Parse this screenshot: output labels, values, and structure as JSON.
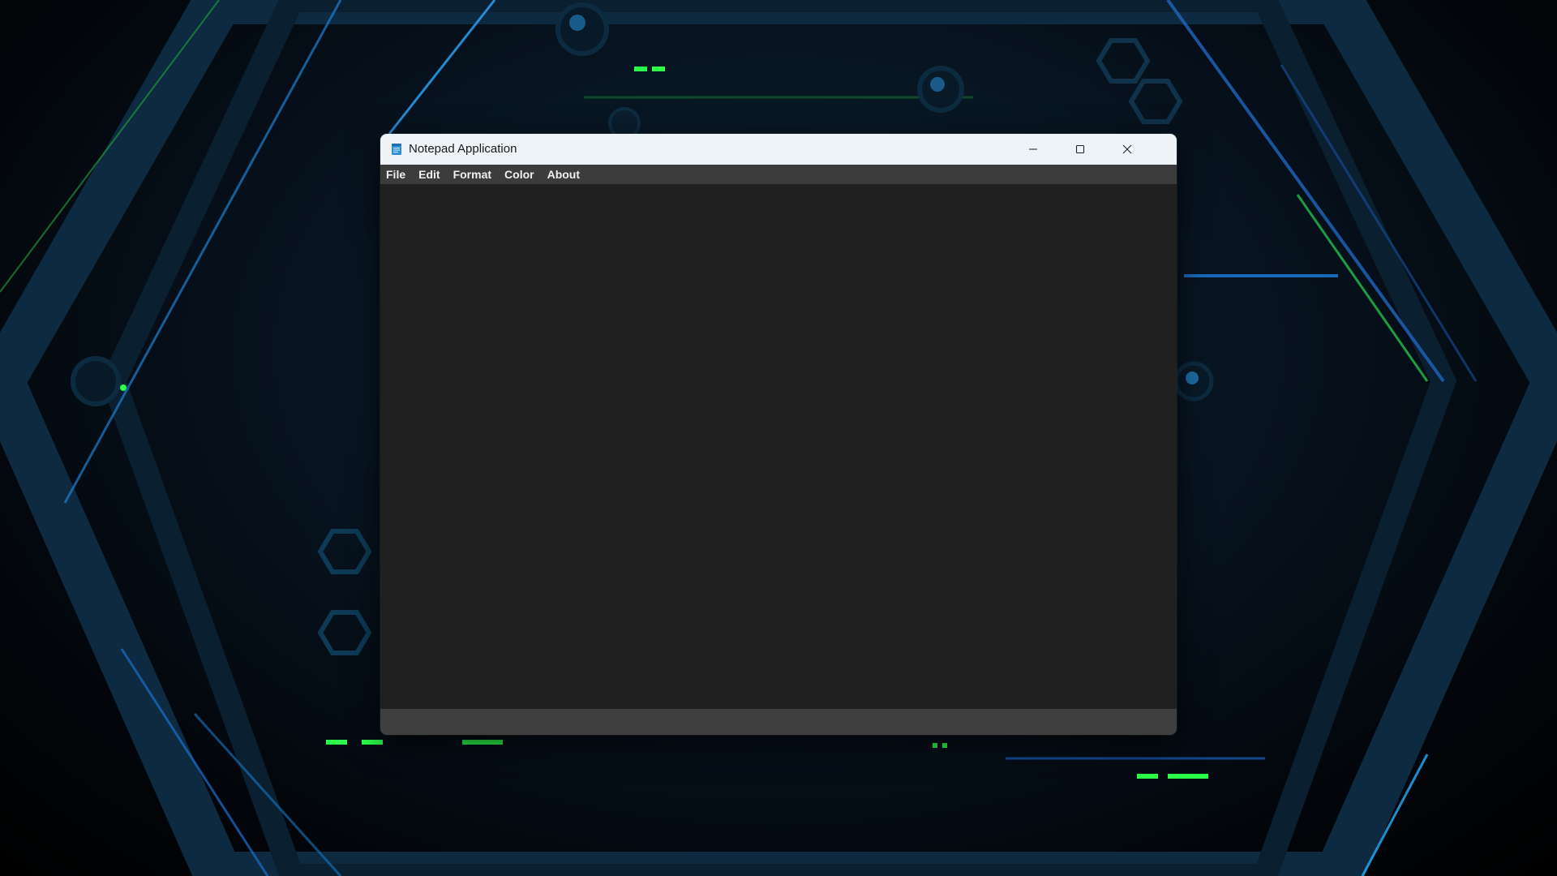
{
  "window": {
    "title": "Notepad Application"
  },
  "menubar": {
    "items": [
      {
        "label": "File"
      },
      {
        "label": "Edit"
      },
      {
        "label": "Format"
      },
      {
        "label": "Color"
      },
      {
        "label": "About"
      }
    ]
  },
  "editor": {
    "content": ""
  },
  "icons": {
    "app": "notepad-icon",
    "minimize": "minimize-icon",
    "maximize": "maximize-icon",
    "close": "close-icon"
  },
  "colors": {
    "titlebar_bg": "#eef3f8",
    "menubar_bg": "#3c3c3c",
    "editor_bg": "#202020",
    "statusbar_bg": "#3f3f3f",
    "wallpaper_accent_green": "#2bff4a",
    "wallpaper_accent_blue": "#1e90ff"
  }
}
